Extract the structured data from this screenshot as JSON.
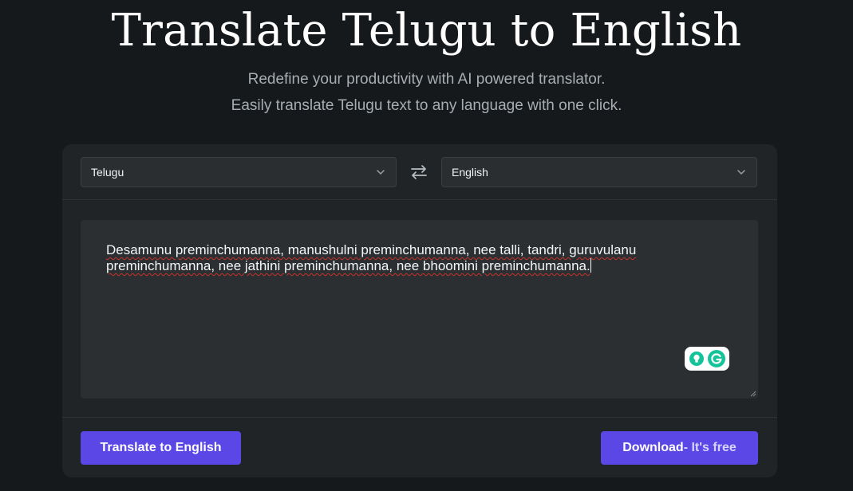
{
  "header": {
    "title": "Translate Telugu to English",
    "subtitle_line1": "Redefine your productivity with AI powered translator.",
    "subtitle_line2": "Easily translate Telugu text to any language with one click."
  },
  "source_language": {
    "selected": "Telugu"
  },
  "target_language": {
    "selected": "English"
  },
  "input": {
    "text": "Desamunu preminchumanna, manushulni preminchumanna, nee talli, tandri, guruvulanu preminchumanna, nee jathini preminchumanna, nee bhoomini preminchumanna."
  },
  "actions": {
    "translate_label": "Translate to English",
    "download_label": "Download",
    "download_suffix": "- It's free"
  },
  "colors": {
    "accent": "#5a47e6",
    "background": "#16191b",
    "card": "#202427",
    "spellcheck": "#c8332b",
    "grammarly_green": "#15c39a"
  },
  "icons": {
    "swap": "swap-arrows-icon",
    "dropdown": "chevron-down-icon",
    "grammarly": "grammarly-icon"
  }
}
